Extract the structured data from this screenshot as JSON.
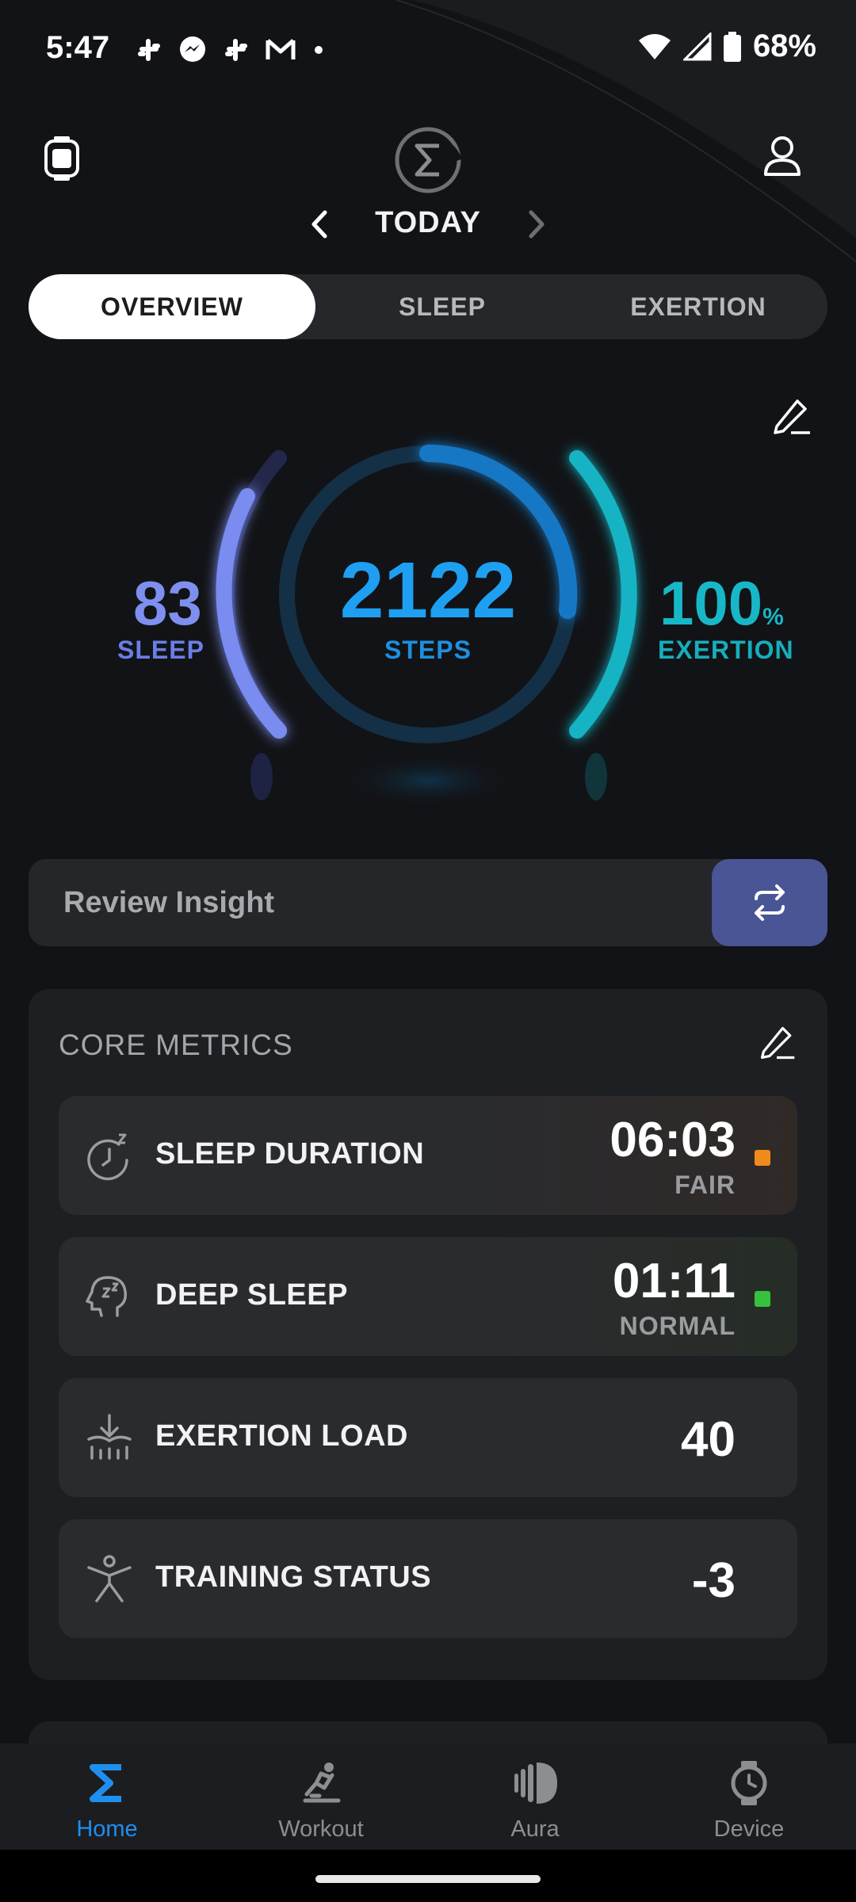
{
  "status_bar": {
    "time": "5:47",
    "left_icons": [
      "slack-icon",
      "messenger-icon",
      "slack-icon",
      "gmail-icon",
      "dot-icon"
    ],
    "right_icons": [
      "wifi-icon",
      "signal-icon",
      "battery-icon"
    ],
    "battery": "68%"
  },
  "header": {
    "date_label": "TODAY",
    "left_icon": "watch-icon",
    "right_icon": "profile-icon",
    "logo": "sigma-logo"
  },
  "tabs": [
    {
      "label": "OVERVIEW",
      "active": true
    },
    {
      "label": "SLEEP",
      "active": false
    },
    {
      "label": "EXERTION",
      "active": false
    }
  ],
  "dashboard": {
    "sleep_value": "83",
    "sleep_label": "SLEEP",
    "steps_value": "2122",
    "steps_label": "STEPS",
    "exertion_value": "100",
    "exertion_unit": "%",
    "exertion_label": "EXERTION",
    "sleep_score": 83,
    "exertion_score": 100,
    "colors": {
      "sleep": "#7e8fef",
      "steps": "#1e9ff2",
      "exertion": "#18b7c7"
    }
  },
  "insight": {
    "label": "Review Insight",
    "button_icon": "swap-icon",
    "button_color": "#4a5596"
  },
  "core_metrics": {
    "title": "CORE METRICS",
    "items": [
      {
        "name": "SLEEP DURATION",
        "value": "06:03",
        "status": "FAIR",
        "status_color": "#f08a1c",
        "icon": "sleep-clock-icon"
      },
      {
        "name": "DEEP SLEEP",
        "value": "01:11",
        "status": "NORMAL",
        "status_color": "#36c23c",
        "icon": "deep-sleep-head-icon"
      },
      {
        "name": "EXERTION LOAD",
        "value": "40",
        "status": "",
        "icon": "exertion-load-icon"
      },
      {
        "name": "TRAINING STATUS",
        "value": "-3",
        "status": "",
        "icon": "person-stretch-icon"
      }
    ]
  },
  "bottom_nav": [
    {
      "label": "Home",
      "icon": "sigma-icon",
      "active": true
    },
    {
      "label": "Workout",
      "icon": "workout-icon",
      "active": false
    },
    {
      "label": "Aura",
      "icon": "aura-icon",
      "active": false
    },
    {
      "label": "Device",
      "icon": "watch-icon",
      "active": false
    }
  ]
}
